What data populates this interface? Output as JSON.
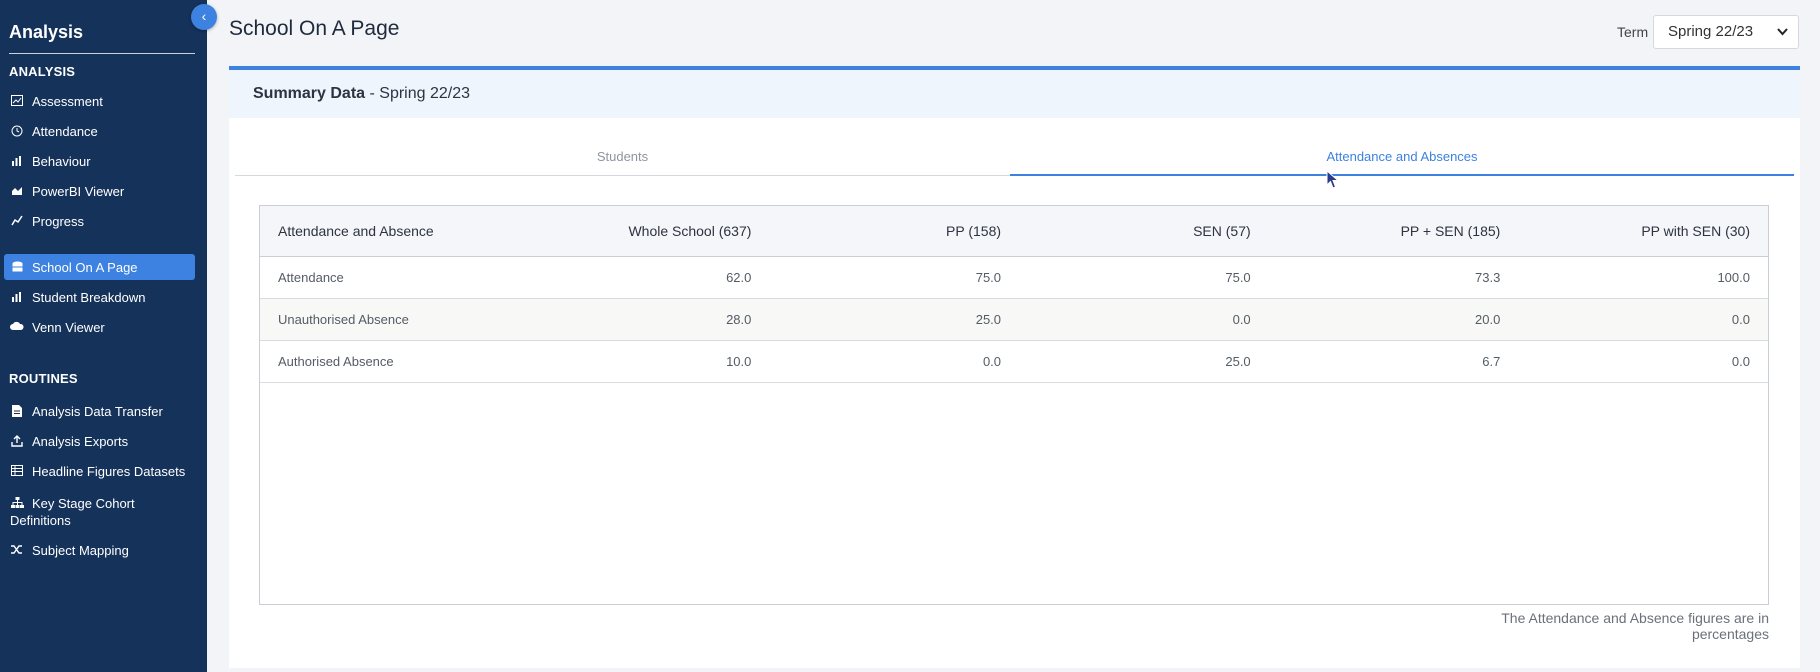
{
  "sidebar": {
    "title": "Analysis",
    "collapse_icon": "‹",
    "sections": [
      {
        "heading": "ANALYSIS",
        "items": [
          {
            "label": "Assessment",
            "icon": "chart-icon"
          },
          {
            "label": "Attendance",
            "icon": "clock-icon"
          },
          {
            "label": "Behaviour",
            "icon": "bar-chart-icon"
          },
          {
            "label": "PowerBI Viewer",
            "icon": "area-chart-icon"
          },
          {
            "label": "Progress",
            "icon": "line-chart-icon"
          },
          {
            "label": "School On A Page",
            "icon": "database-icon"
          },
          {
            "label": "Student Breakdown",
            "icon": "bar-chart-icon"
          },
          {
            "label": "Venn Viewer",
            "icon": "cloud-icon"
          }
        ]
      },
      {
        "heading": "ROUTINES",
        "items": [
          {
            "label": "Analysis Data Transfer",
            "icon": "file-icon"
          },
          {
            "label": "Analysis Exports",
            "icon": "upload-icon"
          },
          {
            "label": "Headline Figures Datasets",
            "icon": "table-icon"
          },
          {
            "label": "Key Stage Cohort Definitions",
            "icon": "sitemap-icon"
          },
          {
            "label": "Subject Mapping",
            "icon": "shuffle-icon"
          }
        ]
      }
    ],
    "active_item": "School On A Page"
  },
  "header": {
    "title": "School On A Page",
    "term_label": "Term",
    "term_value": "Spring 22/23"
  },
  "card": {
    "heading_bold": "Summary Data",
    "heading_rest": " - Spring 22/23",
    "tabs": [
      "Students",
      "Attendance and Absences"
    ],
    "active_tab": "Attendance and Absences"
  },
  "table": {
    "headers": [
      "Attendance and Absence",
      "Whole School (637)",
      "PP (158)",
      "SEN (57)",
      "PP + SEN (185)",
      "PP with SEN (30)"
    ],
    "rows": [
      [
        "Attendance",
        "62.0",
        "75.0",
        "75.0",
        "73.3",
        "100.0"
      ],
      [
        "Unauthorised Absence",
        "28.0",
        "25.0",
        "0.0",
        "20.0",
        "0.0"
      ],
      [
        "Authorised Absence",
        "10.0",
        "0.0",
        "25.0",
        "6.7",
        "0.0"
      ]
    ]
  },
  "note": "The Attendance and Absence figures are in percentages",
  "colors": {
    "sidebar": "#15325a",
    "accent": "#3d82e0",
    "card_head": "#eef5fd"
  }
}
